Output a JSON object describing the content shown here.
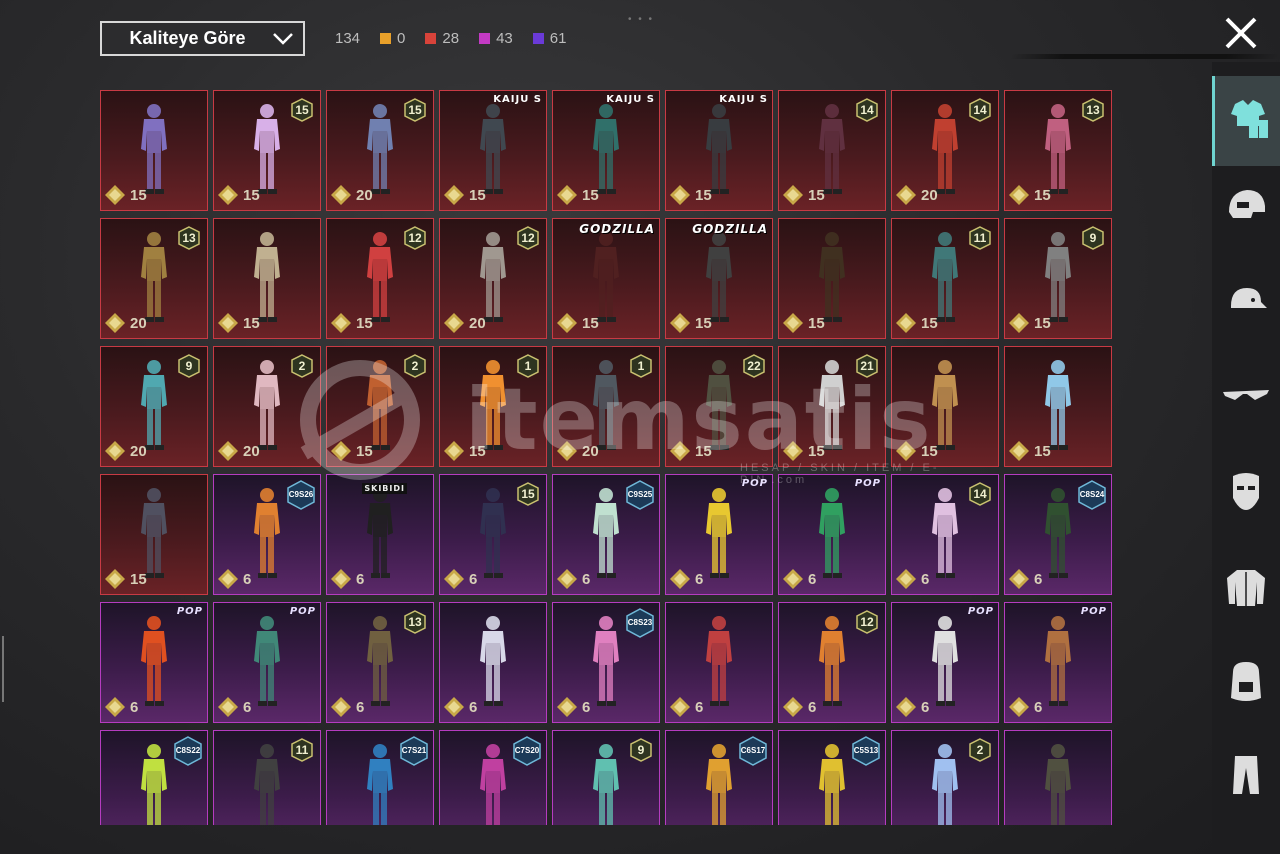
{
  "header": {
    "sort_label": "Kaliteye Göre",
    "total_count": "134",
    "rarity_counts": [
      {
        "color": "#e8a02a",
        "count": "0"
      },
      {
        "color": "#d8433a",
        "count": "28"
      },
      {
        "color": "#c33ac4",
        "count": "43"
      },
      {
        "color": "#6a3ad8",
        "count": "61"
      }
    ]
  },
  "watermark": {
    "brand": "itemsatis",
    "tagline": "HESAP / SKIN / ITEM / E-PIN",
    "domain": ".com"
  },
  "sidebar": {
    "categories": [
      {
        "icon": "outfit-icon",
        "active": true
      },
      {
        "icon": "helmet-icon",
        "active": false
      },
      {
        "icon": "cap-icon",
        "active": false
      },
      {
        "icon": "glasses-icon",
        "active": false
      },
      {
        "icon": "mask-icon",
        "active": false
      },
      {
        "icon": "jacket-icon",
        "active": false
      },
      {
        "icon": "backpack-icon",
        "active": false
      },
      {
        "icon": "pants-icon",
        "active": false
      }
    ]
  },
  "items": [
    {
      "rarity": "legendary",
      "value": "15",
      "badge": "",
      "tag": "",
      "color": "#8070c0"
    },
    {
      "rarity": "legendary",
      "value": "15",
      "badge": "15",
      "tag": "",
      "color": "#d8b0e8"
    },
    {
      "rarity": "legendary",
      "value": "20",
      "badge": "15",
      "tag": "",
      "color": "#7080b0"
    },
    {
      "rarity": "legendary",
      "value": "15",
      "badge": "",
      "tag": "KAIJU S",
      "color": "#404850"
    },
    {
      "rarity": "legendary",
      "value": "15",
      "badge": "",
      "tag": "KAIJU S",
      "color": "#30706a"
    },
    {
      "rarity": "legendary",
      "value": "15",
      "badge": "",
      "tag": "KAIJU S",
      "color": "#383c40"
    },
    {
      "rarity": "legendary",
      "value": "15",
      "badge": "14",
      "tag": "",
      "color": "#603040"
    },
    {
      "rarity": "legendary",
      "value": "20",
      "badge": "14",
      "tag": "",
      "color": "#c04030"
    },
    {
      "rarity": "legendary",
      "value": "15",
      "badge": "13",
      "tag": "",
      "color": "#c06080"
    },
    {
      "rarity": "legendary",
      "value": "20",
      "badge": "13",
      "tag": "",
      "color": "#a08040"
    },
    {
      "rarity": "legendary",
      "value": "15",
      "badge": "",
      "tag": "",
      "color": "#c0b090"
    },
    {
      "rarity": "legendary",
      "value": "15",
      "badge": "12",
      "tag": "",
      "color": "#d04040"
    },
    {
      "rarity": "legendary",
      "value": "20",
      "badge": "12",
      "tag": "",
      "color": "#a09890"
    },
    {
      "rarity": "legendary",
      "value": "15",
      "badge": "",
      "tag": "GODZILLA",
      "color": "#502020"
    },
    {
      "rarity": "legendary",
      "value": "15",
      "badge": "",
      "tag": "GODZILLA",
      "color": "#404040"
    },
    {
      "rarity": "legendary",
      "value": "15",
      "badge": "",
      "tag": "",
      "color": "#403020"
    },
    {
      "rarity": "legendary",
      "value": "15",
      "badge": "11",
      "tag": "",
      "color": "#407878"
    },
    {
      "rarity": "legendary",
      "value": "15",
      "badge": "9",
      "tag": "",
      "color": "#808080"
    },
    {
      "rarity": "legendary",
      "value": "20",
      "badge": "9",
      "tag": "",
      "color": "#50a8b0"
    },
    {
      "rarity": "legendary",
      "value": "20",
      "badge": "2",
      "tag": "",
      "color": "#e0b8c0"
    },
    {
      "rarity": "legendary",
      "value": "15",
      "badge": "2",
      "tag": "",
      "color": "#c06030"
    },
    {
      "rarity": "legendary",
      "value": "15",
      "badge": "1",
      "tag": "",
      "color": "#f09030"
    },
    {
      "rarity": "legendary",
      "value": "20",
      "badge": "1",
      "tag": "",
      "color": "#505860"
    },
    {
      "rarity": "legendary",
      "value": "15",
      "badge": "22",
      "tag": "",
      "color": "#505040"
    },
    {
      "rarity": "legendary",
      "value": "15",
      "badge": "21",
      "tag": "",
      "color": "#d0d0d0"
    },
    {
      "rarity": "legendary",
      "value": "15",
      "badge": "",
      "tag": "",
      "color": "#c09050"
    },
    {
      "rarity": "legendary",
      "value": "15",
      "badge": "",
      "tag": "",
      "color": "#90c8e8"
    },
    {
      "rarity": "legendary",
      "value": "15",
      "badge": "",
      "tag": "",
      "color": "#505060"
    },
    {
      "rarity": "epic",
      "value": "6",
      "badge": "C9S26",
      "tag": "",
      "color": "#e08030"
    },
    {
      "rarity": "epic",
      "value": "6",
      "badge": "",
      "tag": "SKIBIDI",
      "color": "#202020"
    },
    {
      "rarity": "epic",
      "value": "6",
      "badge": "15",
      "tag": "",
      "color": "#303050"
    },
    {
      "rarity": "epic",
      "value": "6",
      "badge": "C9S25",
      "tag": "",
      "color": "#c0e0d0"
    },
    {
      "rarity": "epic",
      "value": "6",
      "badge": "",
      "tag": "POP",
      "color": "#e8c830"
    },
    {
      "rarity": "epic",
      "value": "6",
      "badge": "",
      "tag": "POP",
      "color": "#30a060"
    },
    {
      "rarity": "epic",
      "value": "6",
      "badge": "14",
      "tag": "",
      "color": "#e0c0e0"
    },
    {
      "rarity": "epic",
      "value": "6",
      "badge": "C8S24",
      "tag": "",
      "color": "#305030"
    },
    {
      "rarity": "epic",
      "value": "6",
      "badge": "",
      "tag": "POP",
      "color": "#e05020"
    },
    {
      "rarity": "epic",
      "value": "6",
      "badge": "",
      "tag": "POP",
      "color": "#408878"
    },
    {
      "rarity": "epic",
      "value": "6",
      "badge": "13",
      "tag": "",
      "color": "#706040"
    },
    {
      "rarity": "epic",
      "value": "6",
      "badge": "",
      "tag": "",
      "color": "#d8d8e8"
    },
    {
      "rarity": "epic",
      "value": "6",
      "badge": "C8S23",
      "tag": "",
      "color": "#e080c0"
    },
    {
      "rarity": "epic",
      "value": "6",
      "badge": "",
      "tag": "",
      "color": "#c04040"
    },
    {
      "rarity": "epic",
      "value": "6",
      "badge": "12",
      "tag": "",
      "color": "#e08030"
    },
    {
      "rarity": "epic",
      "value": "6",
      "badge": "",
      "tag": "POP",
      "color": "#e0e0e0"
    },
    {
      "rarity": "epic",
      "value": "6",
      "badge": "",
      "tag": "POP",
      "color": "#b07040"
    },
    {
      "rarity": "epic",
      "value": "",
      "badge": "C8S22",
      "tag": "",
      "color": "#c0e040"
    },
    {
      "rarity": "epic",
      "value": "",
      "badge": "11",
      "tag": "",
      "color": "#404040"
    },
    {
      "rarity": "epic",
      "value": "",
      "badge": "C7S21",
      "tag": "",
      "color": "#3080c0"
    },
    {
      "rarity": "epic",
      "value": "",
      "badge": "C7S20",
      "tag": "",
      "color": "#c040a0"
    },
    {
      "rarity": "epic",
      "value": "",
      "badge": "9",
      "tag": "",
      "color": "#60c0b0"
    },
    {
      "rarity": "epic",
      "value": "",
      "badge": "C6S17",
      "tag": "",
      "color": "#e0a030"
    },
    {
      "rarity": "epic",
      "value": "",
      "badge": "C5S13",
      "tag": "",
      "color": "#e0c030"
    },
    {
      "rarity": "epic",
      "value": "",
      "badge": "2",
      "tag": "",
      "color": "#a0c0f0"
    },
    {
      "rarity": "epic",
      "value": "",
      "badge": "",
      "tag": "",
      "color": "#505040"
    }
  ]
}
